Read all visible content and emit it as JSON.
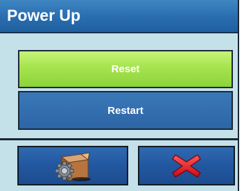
{
  "window": {
    "title": "Power Up"
  },
  "buttons": {
    "reset_label": "Reset",
    "restart_label": "Restart"
  },
  "softkeys": [
    {
      "icon": "setup-box-gear-icon"
    },
    {
      "icon": "close-x-icon"
    }
  ],
  "colors": {
    "title_bar": "#2a6fb0",
    "background": "#c4e1ea",
    "reset_button": "#a8e551",
    "restart_button": "#2d65a5",
    "softkey": "#2257a0",
    "cancel_icon": "#e0121a"
  }
}
